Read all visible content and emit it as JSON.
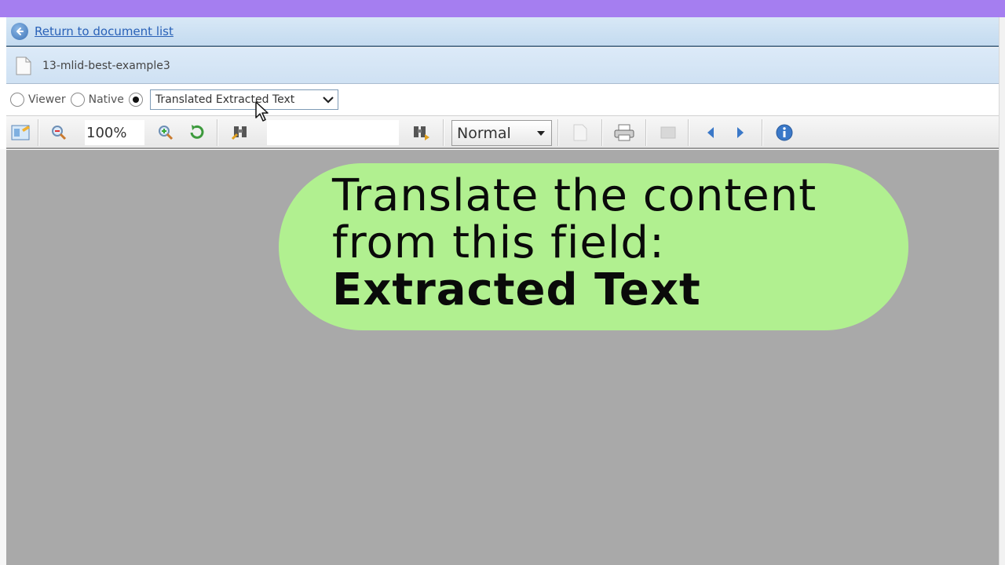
{
  "nav": {
    "return_label": "Return to document list"
  },
  "document": {
    "name": "13-mlid-best-example3"
  },
  "view_modes": {
    "options": [
      "Viewer",
      "Native"
    ],
    "selected_value": "Translated Extracted Text"
  },
  "toolbar": {
    "zoom": "100%",
    "page_input": "",
    "display_mode": "Normal"
  },
  "callout": {
    "line1": "Translate the content",
    "line2": "from this field:",
    "line3": "Extracted Text"
  },
  "colors": {
    "accent": "#a57ef0",
    "callout_bg": "#b1f090",
    "viewer_bg": "#a9a9a9",
    "link": "#2a62b8"
  }
}
